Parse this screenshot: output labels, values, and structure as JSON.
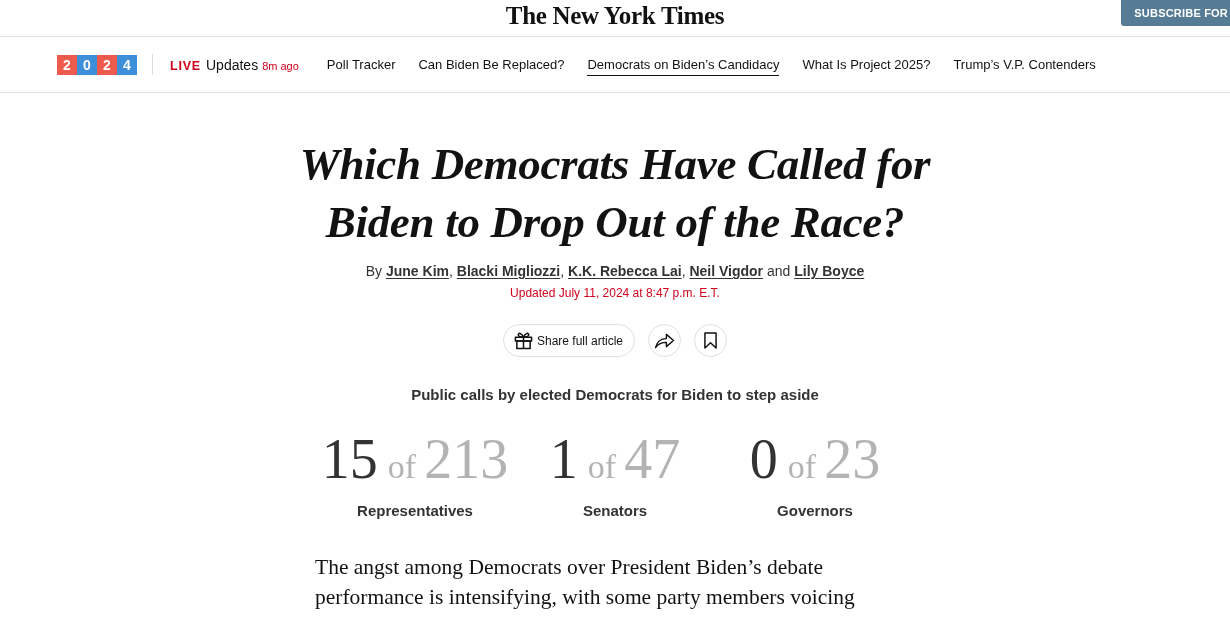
{
  "masthead": {
    "logo": "The New York Times",
    "subscribe_button": "SUBSCRIBE FOR"
  },
  "nav": {
    "badge": [
      {
        "digit": "2",
        "color": "#ee5a4b"
      },
      {
        "digit": "0",
        "color": "#3d8fd9"
      },
      {
        "digit": "2",
        "color": "#ee5a4b"
      },
      {
        "digit": "4",
        "color": "#3d8fd9"
      }
    ],
    "live": {
      "label": "LIVE",
      "text": "Updates",
      "time": "8m ago"
    },
    "links": [
      {
        "label": "Poll Tracker",
        "selected": false
      },
      {
        "label": "Can Biden Be Replaced?",
        "selected": false
      },
      {
        "label": "Democrats on Biden’s Candidacy",
        "selected": true
      },
      {
        "label": "What Is Project 2025?",
        "selected": false
      },
      {
        "label": "Trump’s V.P. Contenders",
        "selected": false
      }
    ]
  },
  "article": {
    "headline": "Which Democrats Have Called for Biden to Drop Out of the Race?",
    "byline": [
      {
        "kind": "text",
        "text": "By "
      },
      {
        "kind": "link",
        "text": "June Kim"
      },
      {
        "kind": "text",
        "text": ", "
      },
      {
        "kind": "link",
        "text": "Blacki Migliozzi"
      },
      {
        "kind": "text",
        "text": ", "
      },
      {
        "kind": "link",
        "text": "K.K. Rebecca Lai"
      },
      {
        "kind": "text",
        "text": ", "
      },
      {
        "kind": "link",
        "text": "Neil Vigdor"
      },
      {
        "kind": "text",
        "text": " and "
      },
      {
        "kind": "link",
        "text": "Lily Boyce"
      }
    ],
    "updated": "Updated July 11, 2024 at 8:47 p.m. E.T.",
    "share_button": "Share full article"
  },
  "tally": {
    "title": "Public calls by elected Democrats for Biden to step aside",
    "items": [
      {
        "count": "15",
        "connector": "of",
        "total": "213",
        "label": "Representatives"
      },
      {
        "count": "1",
        "connector": "of",
        "total": "47",
        "label": "Senators"
      },
      {
        "count": "0",
        "connector": "of",
        "total": "23",
        "label": "Governors"
      }
    ]
  },
  "body": {
    "paragraph": "The angst among Democrats over President Biden’s debate performance is intensifying, with some party members voicing"
  }
}
